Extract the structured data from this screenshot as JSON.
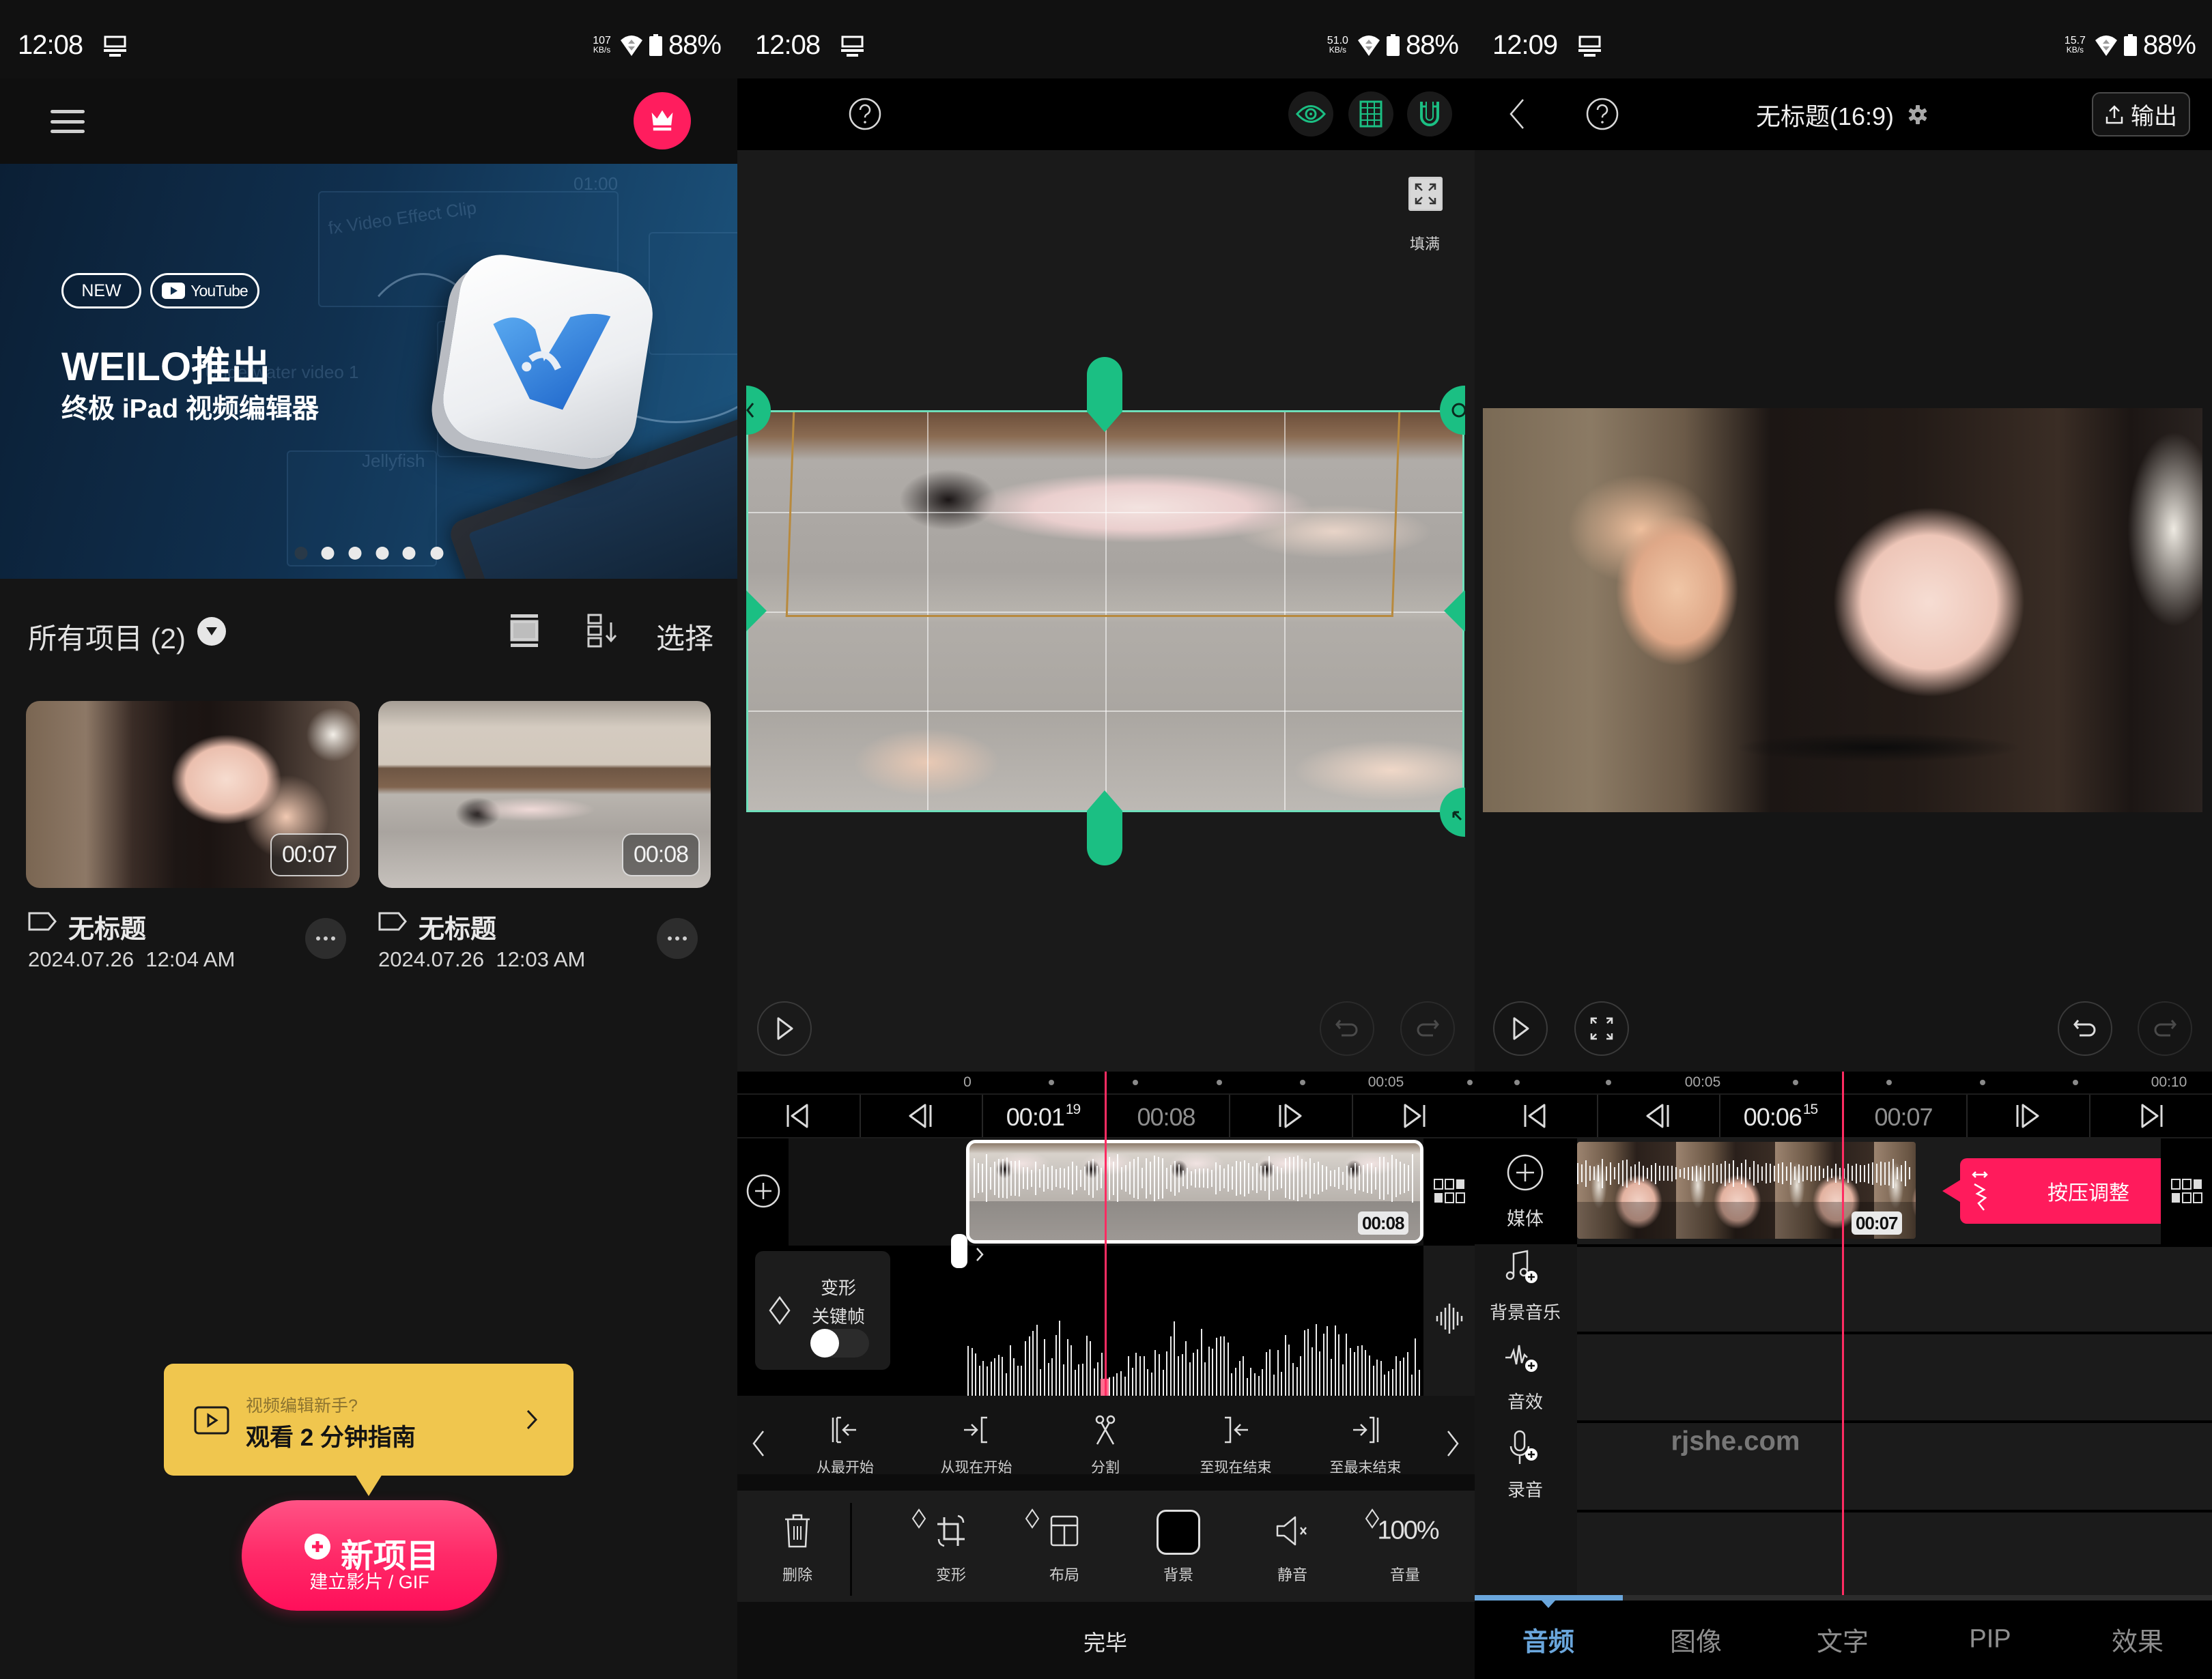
{
  "theme": {
    "accent_pink": "#ff1d5e",
    "accent_green": "#1bbf83",
    "frame_mint": "#6fe0bb",
    "tab_active_blue": "#6aa6dc",
    "guide_yellow": "#f0c64e"
  },
  "home": {
    "status_bar": {
      "time": "12:08",
      "net_speed": "107",
      "net_unit": "KB/s",
      "battery": "88%"
    },
    "header": {
      "menu_icon": "hamburger-icon",
      "premium_icon": "crown-icon"
    },
    "banner": {
      "badge_new": "NEW",
      "badge_youtube": "YouTube",
      "headline": "WEILO推出",
      "subheadline": "终极 iPad 视频编辑器",
      "background_text": [
        "fx Video Effect Clip",
        "01:00",
        "Underwater video 1",
        "Jellyfish"
      ],
      "slide_count": 6,
      "active_slide": 1
    },
    "projects": {
      "title": "所有项目 (2)",
      "select_label": "选择",
      "items": [
        {
          "title": "无标题",
          "date": "2024.07.26  12:04 AM",
          "duration": "00:07"
        },
        {
          "title": "无标题",
          "date": "2024.07.26  12:03 AM",
          "duration": "00:08"
        }
      ]
    },
    "guide": {
      "question": "视频编辑新手?",
      "cta": "观看 2 分钟指南"
    },
    "new_project": {
      "label": "新项目",
      "sublabel": "建立影片 / GIF"
    }
  },
  "transform_editor": {
    "status_bar": {
      "time": "12:08",
      "net_speed": "51.0",
      "net_unit": "KB/s",
      "battery": "88%"
    },
    "toolbar_toggles": [
      "eye-icon",
      "grid-icon",
      "magnet-icon"
    ],
    "fill_label": "填满",
    "ruler": {
      "labels": [
        "0",
        "00:05"
      ]
    },
    "transport": {
      "current_time": "00:01",
      "current_frames": "19",
      "total_time": "00:08"
    },
    "clip": {
      "duration": "00:08",
      "selected": true
    },
    "keyframe": {
      "title": "变形",
      "subtitle": "关键帧",
      "enabled": false
    },
    "edit_actions": [
      "从最开始",
      "从现在开始",
      "分割",
      "至现在结束",
      "至最末结束"
    ],
    "tools": [
      {
        "label": "删除"
      },
      {
        "label": "变形"
      },
      {
        "label": "布局"
      },
      {
        "label": "背景"
      },
      {
        "label": "静音"
      },
      {
        "label": "音量",
        "value": "100%"
      }
    ],
    "done_label": "完毕"
  },
  "timeline_editor": {
    "status_bar": {
      "time": "12:09",
      "net_speed": "15.7",
      "net_unit": "KB/s",
      "battery": "88%"
    },
    "title": "无标题(16:9)",
    "export_label": "输出",
    "ruler": {
      "labels": [
        "00:05",
        "00:10"
      ]
    },
    "transport": {
      "current_time": "00:06",
      "current_frames": "15",
      "total_time": "00:07"
    },
    "clip": {
      "duration": "00:07",
      "selected": false
    },
    "track_tools": [
      "媒体",
      "背景音乐",
      "音效",
      "录音"
    ],
    "tooltip": "按压调整",
    "watermark": "rjshe.com",
    "tabs": [
      "音频",
      "图像",
      "文字",
      "PIP",
      "效果"
    ],
    "active_tab": "音频"
  }
}
